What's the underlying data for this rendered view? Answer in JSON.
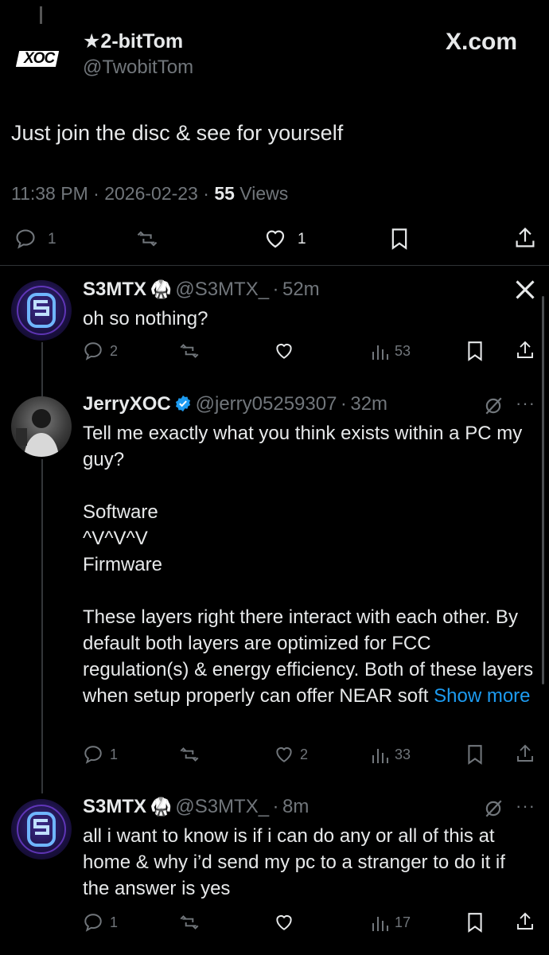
{
  "main_post": {
    "display_name": "★2-bitTom",
    "handle": "@TwobitTom",
    "brand": "X.com",
    "avatar_text": "XOC",
    "text": "Just join the disc & see for yourself",
    "time": "11:38 PM",
    "date": "2026-02-23",
    "views_count": "55",
    "views_label": "Views",
    "reply_count": "1",
    "like_count": "1"
  },
  "replies": [
    {
      "display_name": "S3MTX",
      "handle": "@S3MTX_",
      "age": "52m",
      "text": "oh so nothing?",
      "reply_count": "2",
      "like_count": "",
      "view_count": "53"
    },
    {
      "display_name": "JerryXOC",
      "handle": "@jerry05259307",
      "age": "32m",
      "text": "Tell me exactly what you think exists within a PC my guy?\n\nSoftware\n^V^V^V\nFirmware\n\nThese layers right there interact with each other. By default both layers are optimized for FCC regulation(s) & energy efficiency. Both of these layers when setup properly can offer NEAR soft ",
      "show_more": "Show more",
      "reply_count": "1",
      "like_count": "2",
      "view_count": "33"
    },
    {
      "display_name": "S3MTX",
      "handle": "@S3MTX_",
      "age": "8m",
      "text": "all i want to know is if i can do any or all of this at home & why i’d send my pc to a stranger to do it if the answer is yes",
      "reply_count": "1",
      "like_count": "",
      "view_count": "17"
    }
  ],
  "separator": "·",
  "colors": {
    "accent": "#1d9bf0",
    "muted": "#71767b",
    "text": "#e7e9ea",
    "divider": "#2f3336"
  }
}
